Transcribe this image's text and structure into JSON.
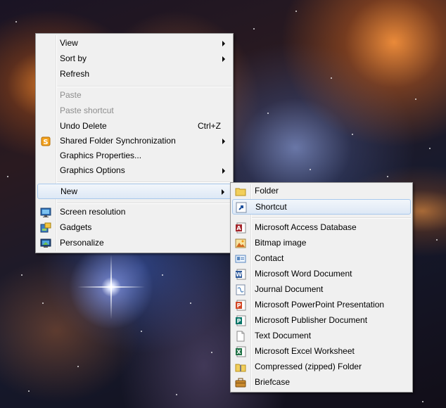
{
  "context_menu": {
    "items": [
      {
        "label": "View",
        "submenu": true
      },
      {
        "label": "Sort by",
        "submenu": true
      },
      {
        "label": "Refresh"
      },
      {
        "label": "Paste",
        "disabled": true
      },
      {
        "label": "Paste shortcut",
        "disabled": true
      },
      {
        "label": "Undo Delete",
        "accelerator": "Ctrl+Z"
      },
      {
        "label": "Shared Folder Synchronization",
        "submenu": true,
        "icon": "shared-folder-sync-icon"
      },
      {
        "label": "Graphics Properties..."
      },
      {
        "label": "Graphics Options",
        "submenu": true
      },
      {
        "label": "New",
        "submenu": true,
        "highlighted": true
      },
      {
        "label": "Screen resolution",
        "icon": "screen-resolution-icon"
      },
      {
        "label": "Gadgets",
        "icon": "gadgets-icon"
      },
      {
        "label": "Personalize",
        "icon": "personalize-icon"
      }
    ]
  },
  "new_submenu": {
    "items": [
      {
        "label": "Folder",
        "icon": "folder-icon"
      },
      {
        "label": "Shortcut",
        "icon": "shortcut-icon",
        "highlighted": true
      },
      {
        "label": "Microsoft Access Database",
        "icon": "access-icon"
      },
      {
        "label": "Bitmap image",
        "icon": "bitmap-icon"
      },
      {
        "label": "Contact",
        "icon": "contact-icon"
      },
      {
        "label": "Microsoft Word Document",
        "icon": "word-icon"
      },
      {
        "label": "Journal Document",
        "icon": "journal-icon"
      },
      {
        "label": "Microsoft PowerPoint Presentation",
        "icon": "powerpoint-icon"
      },
      {
        "label": "Microsoft Publisher Document",
        "icon": "publisher-icon"
      },
      {
        "label": "Text Document",
        "icon": "text-document-icon"
      },
      {
        "label": "Microsoft Excel Worksheet",
        "icon": "excel-icon"
      },
      {
        "label": "Compressed (zipped) Folder",
        "icon": "zip-folder-icon"
      },
      {
        "label": "Briefcase",
        "icon": "briefcase-icon"
      }
    ]
  },
  "colors": {
    "menu_bg": "#f0f0f0",
    "highlight_border": "#a8c8ec",
    "disabled_text": "#8d8d8d"
  }
}
